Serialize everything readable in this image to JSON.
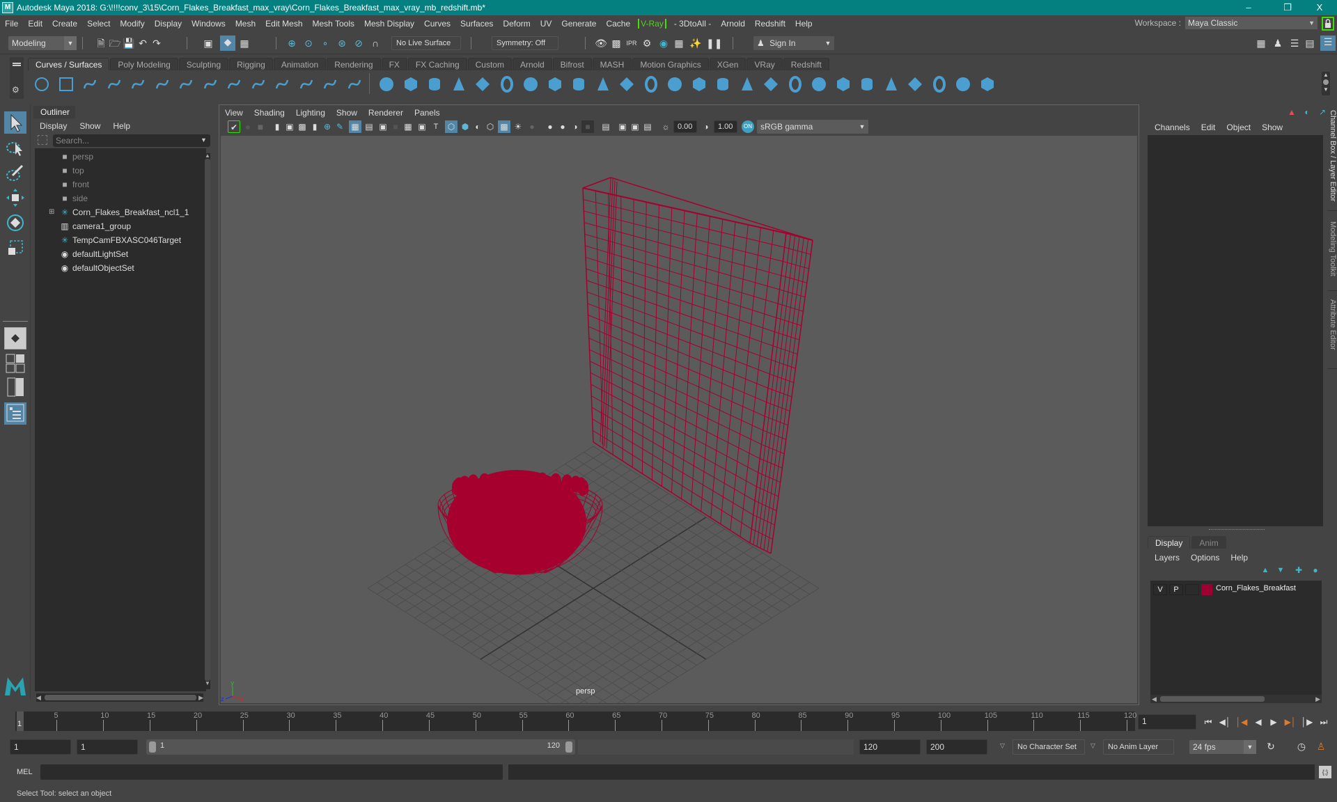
{
  "window": {
    "title": "Autodesk Maya 2018: G:\\!!!!conv_3\\15\\Corn_Flakes_Breakfast_max_vray\\Corn_Flakes_Breakfast_max_vray_mb_redshift.mb*",
    "logo": "M",
    "controls": {
      "minimize": "–",
      "restore": "❐",
      "close": "X"
    }
  },
  "menubar": {
    "items": [
      "File",
      "Edit",
      "Create",
      "Select",
      "Modify",
      "Display",
      "Windows",
      "Mesh",
      "Edit Mesh",
      "Mesh Tools",
      "Mesh Display",
      "Curves",
      "Surfaces",
      "Deform",
      "UV",
      "Generate",
      "Cache"
    ],
    "vray": "V-Ray",
    "items_after": [
      "- 3DtoAll -",
      "Arnold",
      "Redshift",
      "Help"
    ],
    "workspace_label": "Workspace :",
    "workspace_value": "Maya Classic"
  },
  "statusline": {
    "mode": "Modeling",
    "live_surface": "No Live Surface",
    "symmetry": "Symmetry: Off",
    "sign_in": "Sign In"
  },
  "shelf": {
    "tabs": [
      "Curves / Surfaces",
      "Poly Modeling",
      "Sculpting",
      "Rigging",
      "Animation",
      "Rendering",
      "FX",
      "FX Caching",
      "Custom",
      "Arnold",
      "Bifrost",
      "MASH",
      "Motion Graphics",
      "XGen",
      "VRay",
      "Redshift"
    ],
    "active_tab": "Curves / Surfaces",
    "icons": [
      "nurbs-circle-icon",
      "nurbs-square-icon",
      "cv-curve-icon",
      "pencil-curve-icon",
      "ep-curve-icon",
      "bezier-curve-icon",
      "curve-cut-icon",
      "curve-attach-icon",
      "curve-rebuild-icon",
      "arc-icon",
      "offset-curve-icon",
      "duplicate-curve-icon",
      "fillet-icon",
      "insert-knot-icon",
      "nurbs-sphere-icon",
      "nurbs-cube-icon",
      "nurbs-cylinder-icon",
      "nurbs-cone-icon",
      "nurbs-plane-icon",
      "nurbs-torus-icon",
      "revolve-icon",
      "loft-icon",
      "planar-icon",
      "extrude-icon",
      "birail-icon",
      "boundary-icon",
      "square-surface-icon",
      "bevel-icon",
      "intersect-icon",
      "project-curve-icon",
      "trim-icon",
      "untrim-icon",
      "attach-surface-icon",
      "detach-surface-icon",
      "align-icon",
      "open-close-icon",
      "rebuild-surface-icon",
      "stitch-icon",
      "sculpt-surface-icon",
      "surface-fillet-icon"
    ]
  },
  "outliner": {
    "title": "Outliner",
    "menu": [
      "Display",
      "Show",
      "Help"
    ],
    "search_placeholder": "Search...",
    "items": [
      {
        "name": "persp",
        "icon": "camera-icon",
        "dim": true,
        "expandable": false
      },
      {
        "name": "top",
        "icon": "camera-icon",
        "dim": true,
        "expandable": false
      },
      {
        "name": "front",
        "icon": "camera-icon",
        "dim": true,
        "expandable": false
      },
      {
        "name": "side",
        "icon": "camera-icon",
        "dim": true,
        "expandable": false
      },
      {
        "name": "Corn_Flakes_Breakfast_ncl1_1",
        "icon": "transform-icon",
        "dim": false,
        "expandable": true
      },
      {
        "name": "camera1_group",
        "icon": "group-icon",
        "dim": false,
        "expandable": false
      },
      {
        "name": "TempCamFBXASC046Target",
        "icon": "transform-icon",
        "dim": false,
        "expandable": false
      },
      {
        "name": "defaultLightSet",
        "icon": "set-icon",
        "dim": false,
        "expandable": false
      },
      {
        "name": "defaultObjectSet",
        "icon": "set-icon",
        "dim": false,
        "expandable": false
      }
    ]
  },
  "viewport": {
    "menu": [
      "View",
      "Shading",
      "Lighting",
      "Show",
      "Renderer",
      "Panels"
    ],
    "exposure": "0.00",
    "gamma": "1.00",
    "color_space": "sRGB gamma",
    "camera_label": "persp",
    "axis": {
      "x": "x",
      "y": "y",
      "z": "z"
    },
    "wire_color": "#a5002e"
  },
  "channelbox": {
    "menu": [
      "Channels",
      "Edit",
      "Object",
      "Show"
    ]
  },
  "layer_editor": {
    "tabs": [
      "Display",
      "Anim"
    ],
    "active_tab": "Display",
    "menu": [
      "Layers",
      "Options",
      "Help"
    ],
    "layers": [
      {
        "visible": "V",
        "playback": "P",
        "color": "#9c0030",
        "name": "Corn_Flakes_Breakfast"
      }
    ]
  },
  "side_tabs": [
    "Channel Box / Layer Editor",
    "Modeling Toolkit",
    "Attribute Editor"
  ],
  "timeline": {
    "ticks": [
      5,
      10,
      15,
      20,
      25,
      30,
      35,
      40,
      45,
      50,
      55,
      60,
      65,
      70,
      75,
      80,
      85,
      90,
      95,
      100,
      105,
      110,
      115,
      120
    ],
    "start": 1,
    "end": 120,
    "current_frame_marker": "1",
    "current_frame": "1"
  },
  "range": {
    "start_time": "1",
    "playback_start": "1",
    "slider_start": "1",
    "slider_end": "120",
    "playback_end": "120",
    "end_time": "200",
    "character_set": "No Character Set",
    "anim_layer": "No Anim Layer",
    "fps": "24 fps"
  },
  "command": {
    "language": "MEL"
  },
  "help_line": "Select Tool: select an object"
}
